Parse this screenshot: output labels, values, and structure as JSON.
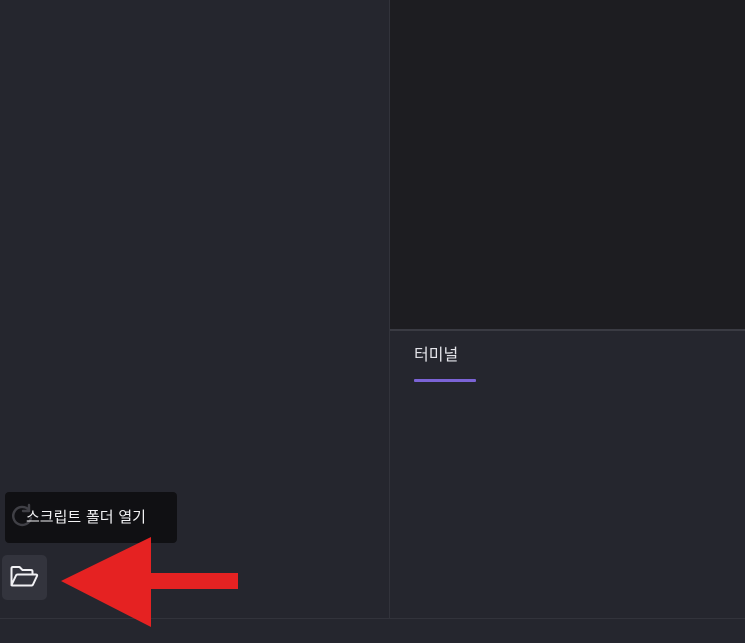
{
  "terminal": {
    "tab_label": "터미널"
  },
  "sidebar": {
    "open_folder_tooltip": "스크립트 폴더 열기",
    "open_folder_icon": "folder-open-icon"
  },
  "colors": {
    "background": "#25262e",
    "editor_background": "#1d1d21",
    "tab_accent": "#7b63d6",
    "tooltip_background": "#101013",
    "annotation_arrow": "#e52222"
  }
}
